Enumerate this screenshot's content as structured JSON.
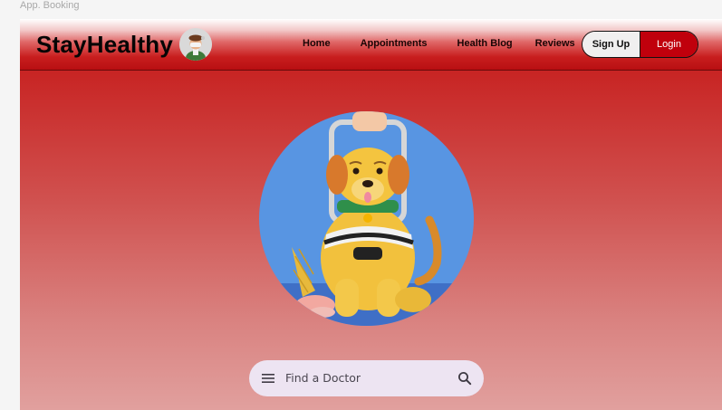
{
  "frame": {
    "label": "App. Booking"
  },
  "brand": {
    "name": "StayHealthy",
    "logo_icon": "doctor-avatar-icon"
  },
  "nav": {
    "items": [
      {
        "label": "Home"
      },
      {
        "label": "Appointments"
      },
      {
        "label": "Health Blog"
      },
      {
        "label": "Reviews"
      }
    ]
  },
  "auth": {
    "signup_label": "Sign Up",
    "login_label": "Login"
  },
  "hero": {
    "illustration": "dog-with-ice-cream-illustration"
  },
  "search": {
    "placeholder": "Find a Doctor",
    "menu_icon": "hamburger-menu-icon",
    "search_icon": "magnifier-icon"
  },
  "colors": {
    "brand_red": "#c0000c",
    "hero_circle": "#5895e2",
    "search_bg": "#ede4f2"
  }
}
